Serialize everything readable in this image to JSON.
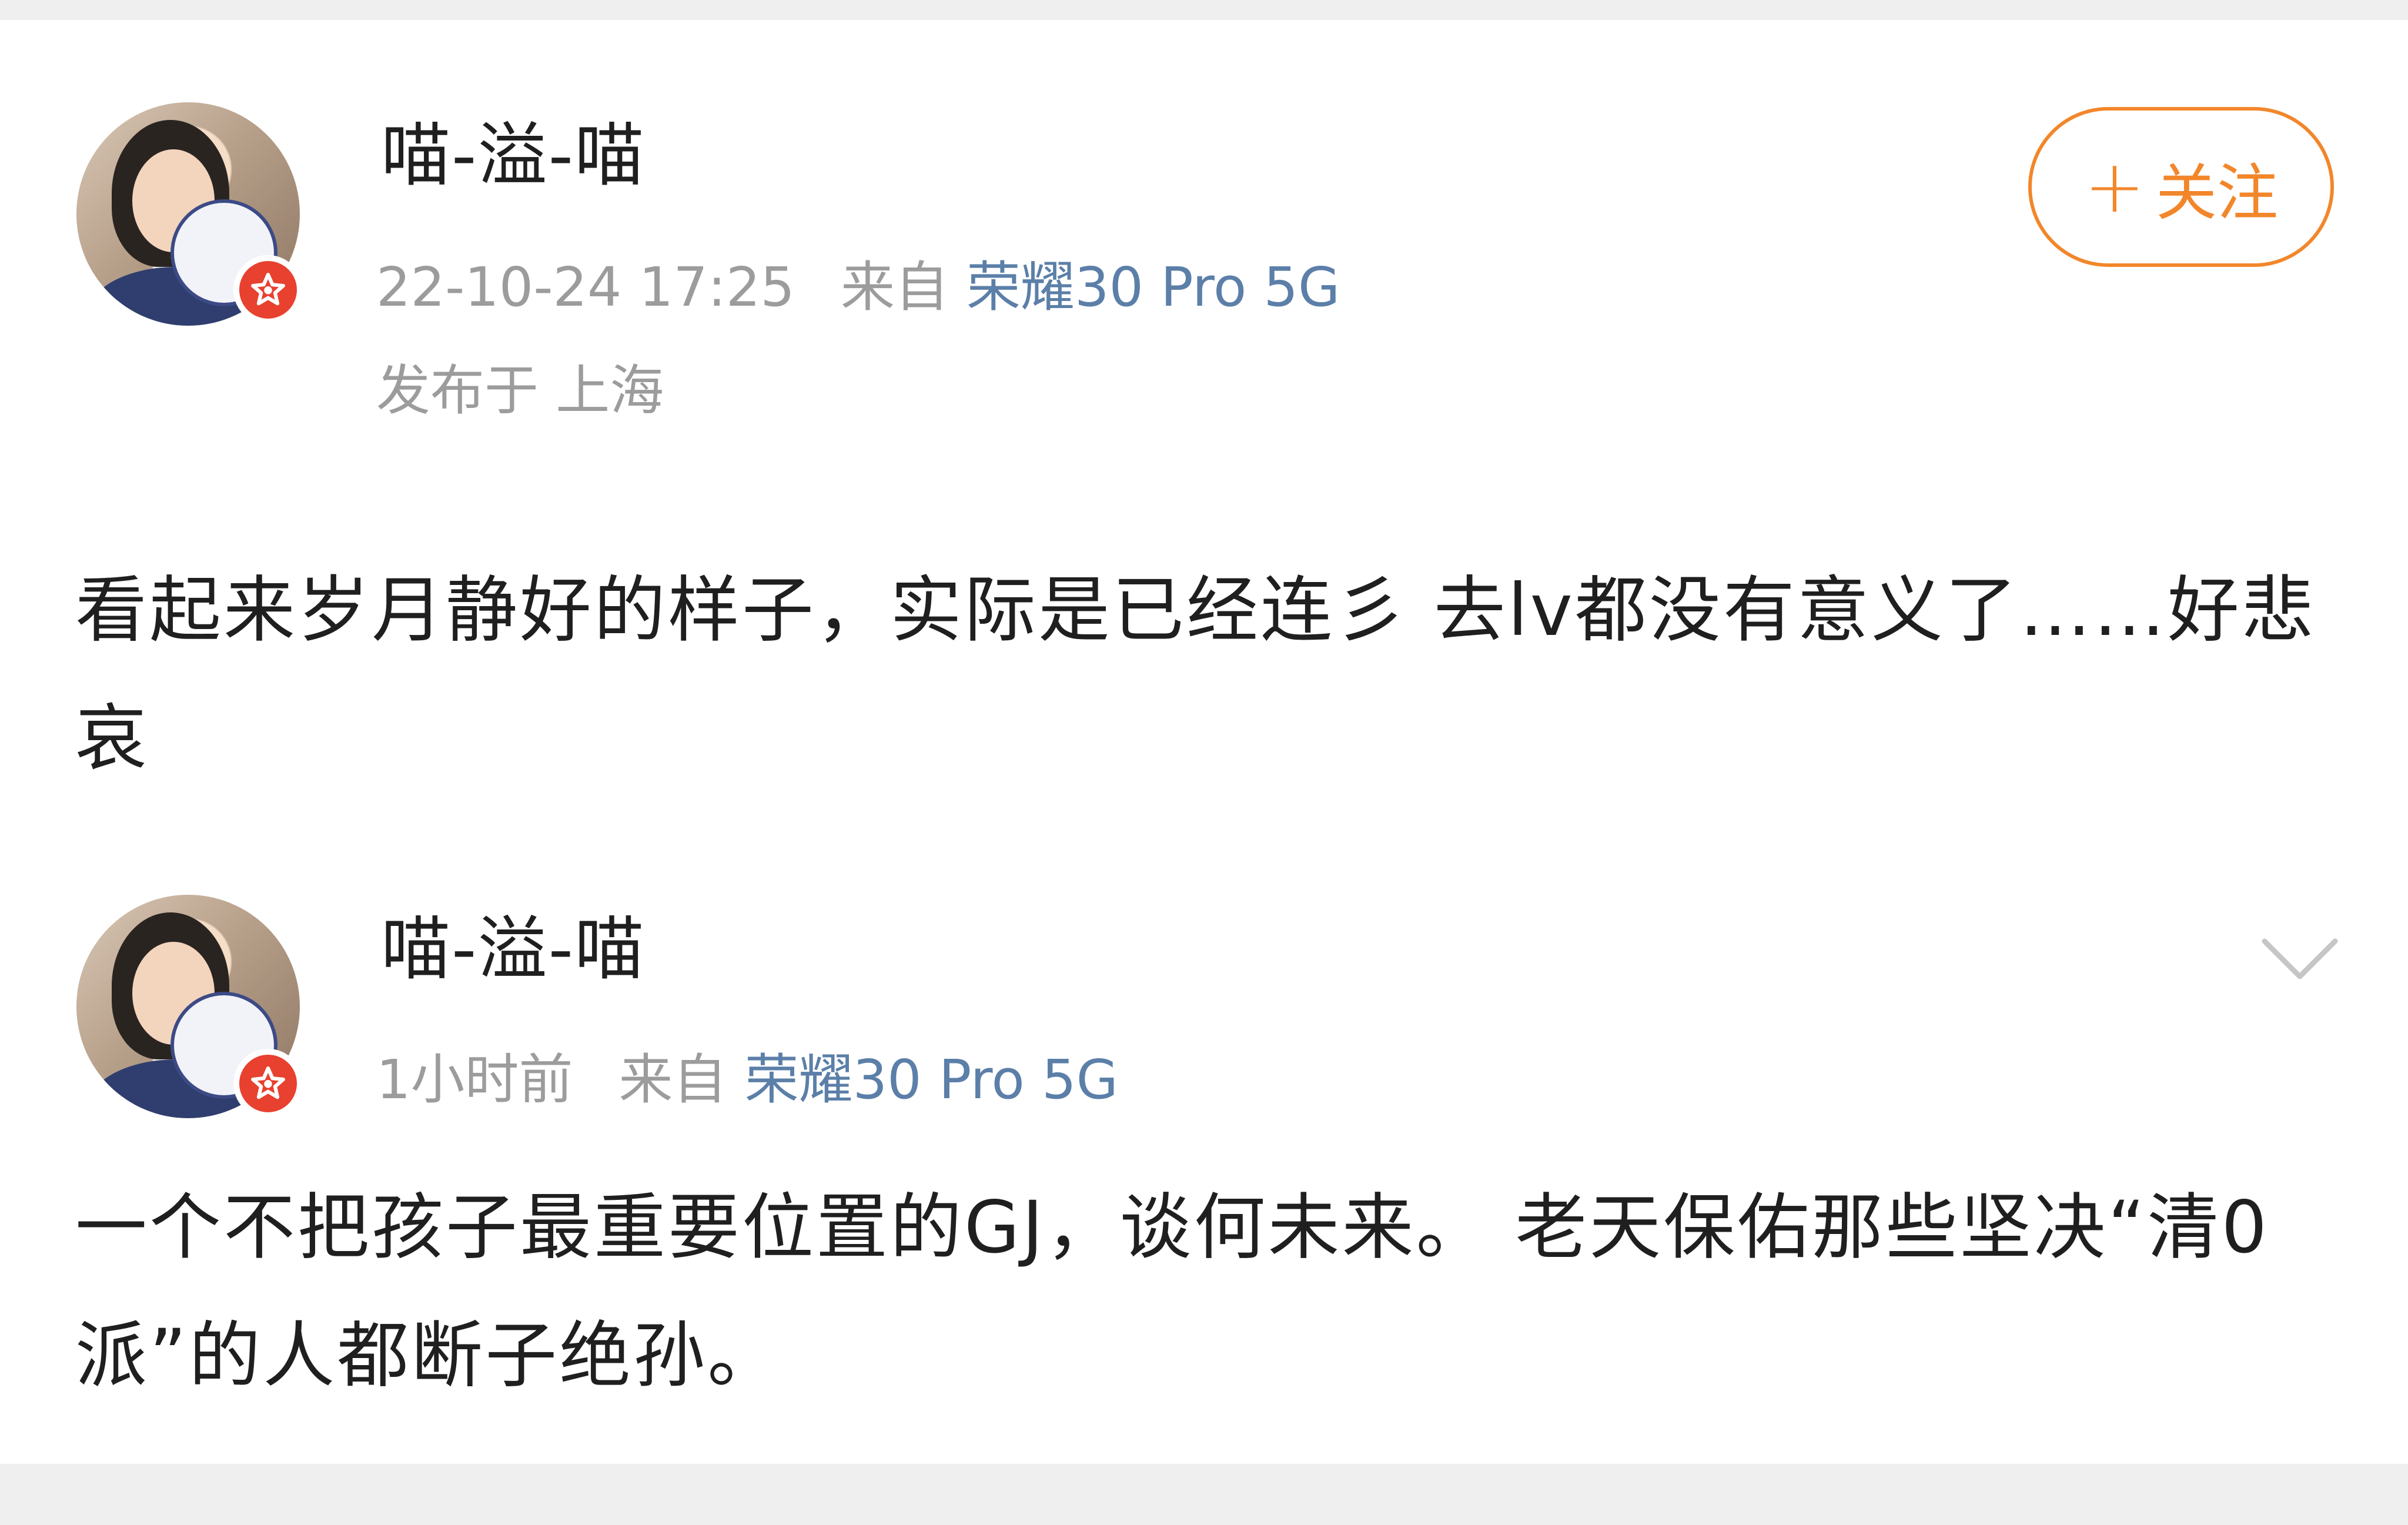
{
  "post": {
    "username": "喵-溢-喵",
    "timestamp": "22-10-24 17:25",
    "from_label": "来自",
    "device": "荣耀30 Pro 5G",
    "location": "发布于 上海",
    "follow_label": "关注",
    "follow_icon": "plus-icon",
    "text": "看起来岁月静好的样子，实际是已经连彡 去lv都没有意义了……好悲哀"
  },
  "comment": {
    "username": "喵-溢-喵",
    "timestamp": "1小时前",
    "from_label": "来自",
    "device": "荣耀30 Pro 5G",
    "text": "一个不把孩子最重要位置的GJ，谈何未来。 老天保佑那些坚决“清0派”的人都断子绝孙。",
    "menu_icon": "chevron-down-icon"
  },
  "colors": {
    "accent_orange": "#f2862a",
    "link_blue": "#5b7fa8",
    "badge_red": "#e8412f",
    "meta_gray": "#9c9c9c"
  }
}
